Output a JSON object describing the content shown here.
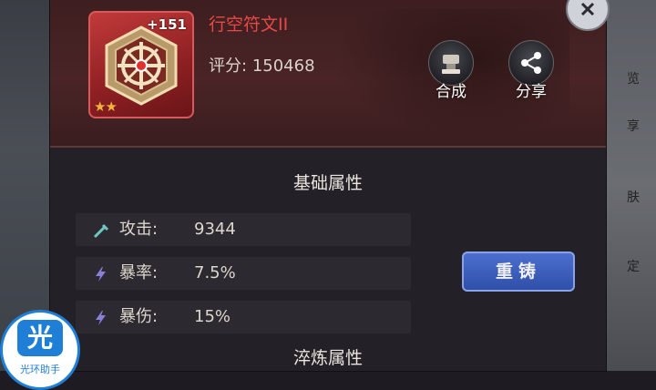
{
  "item": {
    "name": "行空符文II",
    "level": "+151",
    "stars": "★★",
    "score_label": "评分:",
    "score_value": "150468"
  },
  "actions": {
    "merge_label": "合成",
    "share_label": "分享"
  },
  "sections": {
    "base": "基础属性",
    "refine": "淬炼属性"
  },
  "attributes": [
    {
      "label": "攻击:",
      "value": "9344",
      "icon": "sword-icon"
    },
    {
      "label": "暴率:",
      "value": "7.5%",
      "icon": "lightning-icon"
    },
    {
      "label": "暴伤:",
      "value": "15%",
      "icon": "lightning-icon"
    }
  ],
  "recast_label": "重铸",
  "side_menu": [
    "览",
    "享",
    "肤",
    "定"
  ],
  "watermark": {
    "glyph": "光",
    "text": "光环助手"
  },
  "colors": {
    "accent_red": "#e94848",
    "button_blue": "#3a5cbc",
    "star_gold": "#f0b43a"
  }
}
